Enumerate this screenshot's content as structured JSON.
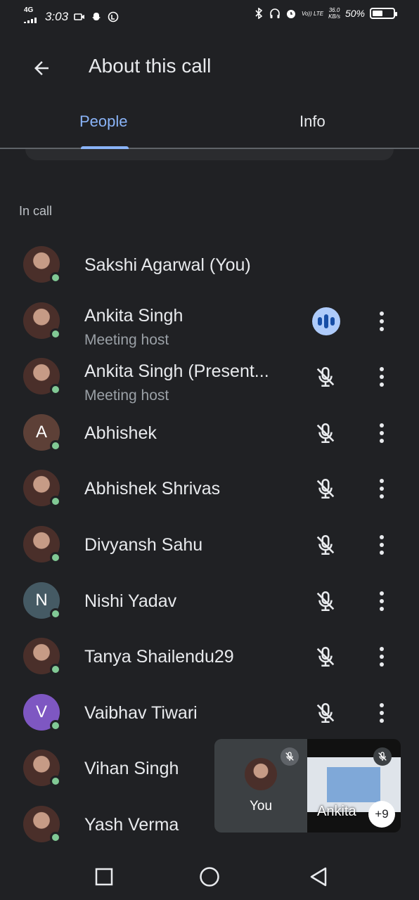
{
  "status_bar": {
    "network": "4G",
    "time": "3:03",
    "volte": "Vo)) LTE",
    "speed_value": "36.0",
    "speed_unit": "KB/s",
    "battery_text": "50%",
    "battery_level": 0.5
  },
  "header": {
    "title": "About this call",
    "back_icon": "arrow-back-icon"
  },
  "tabs": {
    "people": "People",
    "info": "Info",
    "active": "people"
  },
  "section": {
    "label": "In call"
  },
  "participants": [
    {
      "name": "Sakshi Agarwal (You)",
      "subtitle": "",
      "avatar_type": "photo",
      "initial": "",
      "avatar_color": "",
      "mic": "none",
      "show_more": false
    },
    {
      "name": "Ankita Singh",
      "subtitle": "Meeting host",
      "avatar_type": "photo",
      "initial": "",
      "avatar_color": "",
      "mic": "speaking",
      "show_more": true
    },
    {
      "name": "Ankita Singh (Present...",
      "subtitle": "Meeting host",
      "avatar_type": "photo",
      "initial": "",
      "avatar_color": "",
      "mic": "muted",
      "show_more": true
    },
    {
      "name": "Abhishek",
      "subtitle": "",
      "avatar_type": "initial",
      "initial": "A",
      "avatar_color": "#5d4037",
      "mic": "muted",
      "show_more": true
    },
    {
      "name": "Abhishek Shrivas",
      "subtitle": "",
      "avatar_type": "photo",
      "initial": "",
      "avatar_color": "",
      "mic": "muted",
      "show_more": true
    },
    {
      "name": "Divyansh Sahu",
      "subtitle": "",
      "avatar_type": "photo",
      "initial": "",
      "avatar_color": "",
      "mic": "muted",
      "show_more": true
    },
    {
      "name": "Nishi Yadav",
      "subtitle": "",
      "avatar_type": "initial",
      "initial": "N",
      "avatar_color": "#455a64",
      "mic": "muted",
      "show_more": true
    },
    {
      "name": "Tanya Shailendu29",
      "subtitle": "",
      "avatar_type": "photo",
      "initial": "",
      "avatar_color": "",
      "mic": "muted",
      "show_more": true
    },
    {
      "name": "Vaibhav Tiwari",
      "subtitle": "",
      "avatar_type": "initial",
      "initial": "V",
      "avatar_color": "#7e57c2",
      "mic": "muted",
      "show_more": true
    },
    {
      "name": "Vihan Singh",
      "subtitle": "",
      "avatar_type": "photo",
      "initial": "",
      "avatar_color": "",
      "mic": "none",
      "show_more": false
    },
    {
      "name": "Yash Verma",
      "subtitle": "",
      "avatar_type": "photo",
      "initial": "",
      "avatar_color": "",
      "mic": "none",
      "show_more": false
    }
  ],
  "pip": {
    "you_label": "You",
    "presenter_label": "Ankita",
    "more_count": "+9"
  },
  "nav": {
    "recents": "square-icon",
    "home": "circle-icon",
    "back": "triangle-back-icon"
  },
  "colors": {
    "background": "#202124",
    "accent": "#8ab4f8",
    "online": "#81c995",
    "speaking_bg": "#aecbfa"
  }
}
